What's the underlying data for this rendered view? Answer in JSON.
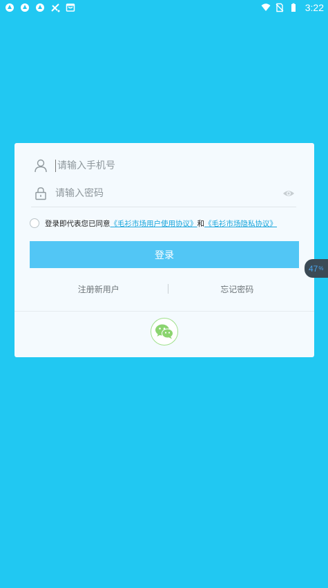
{
  "status_bar": {
    "time": "3:22",
    "left_icons": [
      "app-icon-1",
      "app-icon-2",
      "app-icon-3",
      "satellite-icon",
      "shop-icon"
    ],
    "right_icons": [
      "wifi-icon",
      "no-sim-icon",
      "battery-icon"
    ]
  },
  "login": {
    "phone_placeholder": "请输入手机号",
    "password_placeholder": "请输入密码",
    "agree_prefix": "登录即代表您已同意",
    "user_agreement": "《毛衫市场用户使用协议》",
    "agree_and": "和",
    "privacy_agreement": "《毛衫市场隐私协议》",
    "login_label": "登录",
    "register_label": "注册新用户",
    "forgot_label": "忘记密码",
    "wechat_icon": "wechat-icon"
  },
  "float_badge": {
    "value": "47",
    "unit": "%"
  },
  "colors": {
    "background": "#21c8f2",
    "card": "#f4fafe",
    "button": "#52c6f5",
    "link": "#1aa6dc",
    "wechat": "#8bd46f"
  }
}
